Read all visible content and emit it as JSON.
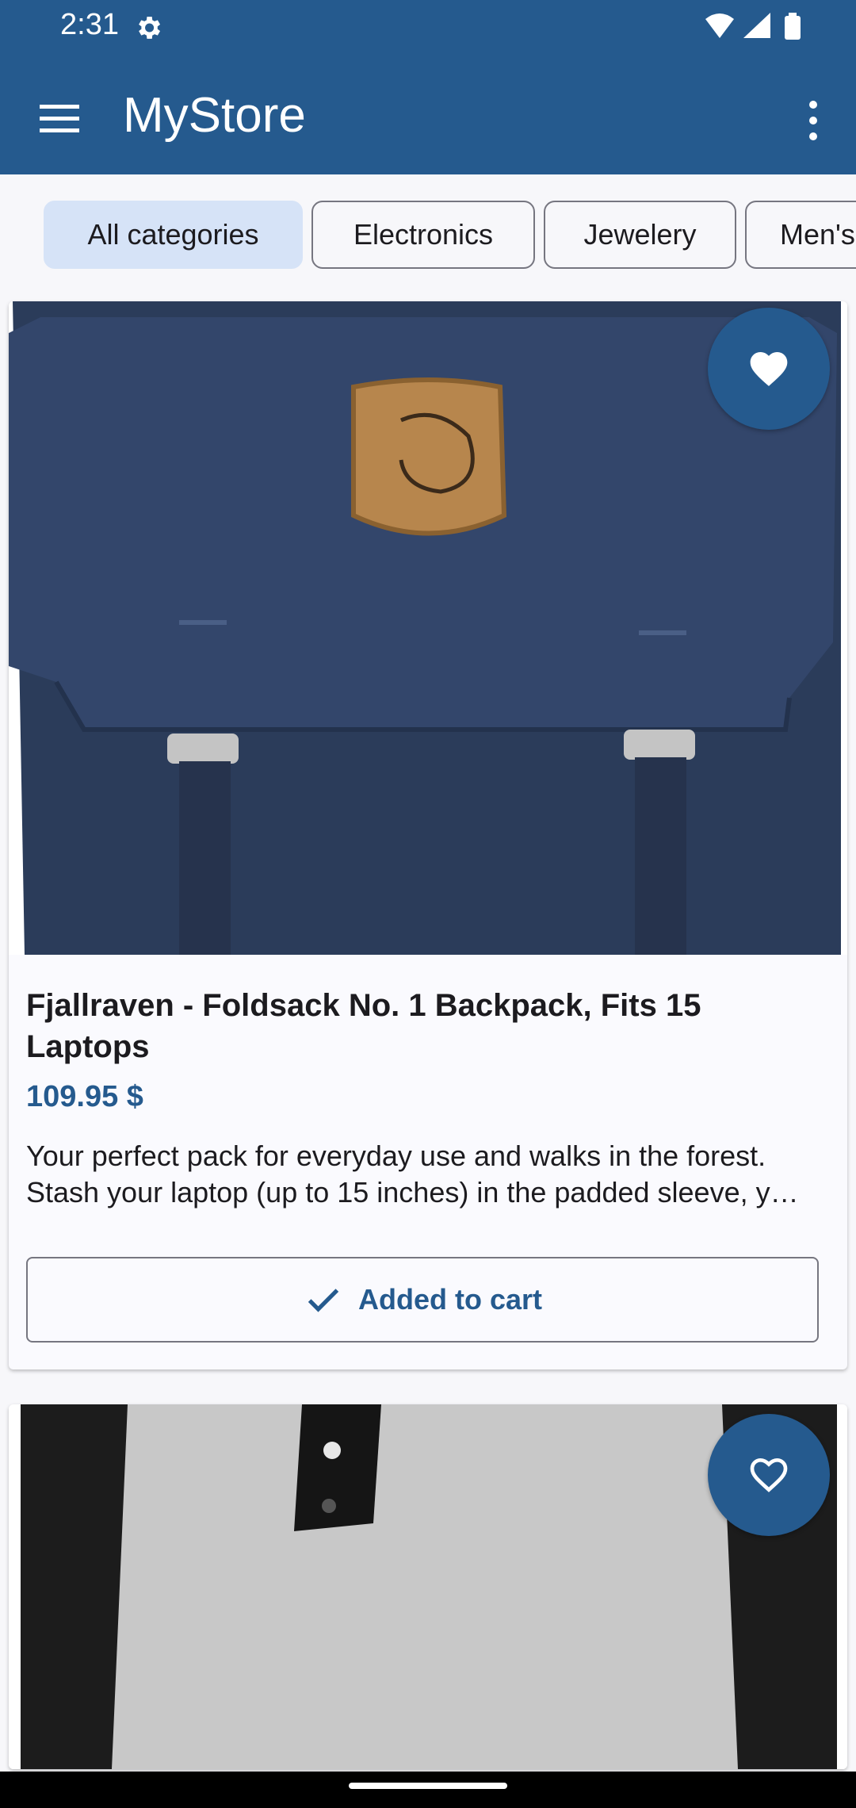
{
  "status_bar": {
    "time": "2:31"
  },
  "app_bar": {
    "title": "MyStore"
  },
  "chips": [
    {
      "label": "All categories",
      "selected": true
    },
    {
      "label": "Electronics",
      "selected": false
    },
    {
      "label": "Jewelery",
      "selected": false
    },
    {
      "label": "Men's",
      "selected": false
    }
  ],
  "products": [
    {
      "title": "Fjallraven - Foldsack No. 1 Backpack, Fits 15 Laptops",
      "price": "109.95 $",
      "description_line1": "Your perfect pack for everyday use and walks in the forest.",
      "description_line2": "Stash your laptop (up to 15 inches) in the padded sleeve, y…",
      "cart_label": "Added to cart",
      "favorite": true,
      "image": "navy-backpack-photo"
    },
    {
      "favorite": false,
      "image": "raglan-tshirt-photo"
    }
  ],
  "colors": {
    "primary": "#255a8e",
    "chip_selected": "#d6e3f7",
    "background": "#f7f7fa"
  },
  "icons": [
    "settings-gear-icon",
    "wifi-icon",
    "signal-icon",
    "battery-icon",
    "menu-icon",
    "overflow-menu-icon",
    "heart-filled-icon",
    "heart-outline-icon",
    "checkmark-icon"
  ]
}
